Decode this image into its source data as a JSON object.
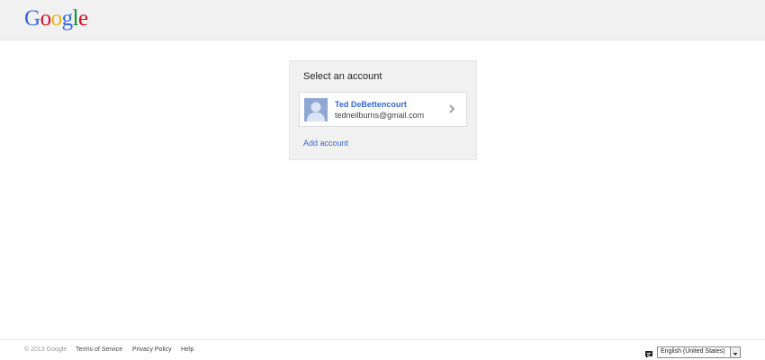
{
  "header": {
    "logo_letters": [
      "G",
      "o",
      "o",
      "g",
      "l",
      "e"
    ]
  },
  "card": {
    "title": "Select an account",
    "account": {
      "name": "Ted DeBettencourt",
      "email": "tedneilburns@gmail.com"
    },
    "add_account_label": "Add account"
  },
  "footer": {
    "copyright": "© 2013 Google",
    "links": [
      "Terms of Service",
      "Privacy Policy",
      "Help"
    ],
    "language_selected": "English (United States)"
  },
  "icons": {
    "logo": "google-logo",
    "avatar": "default-avatar-icon",
    "chevron": "chevron-right-icon",
    "language": "speech-bubble-icon",
    "dropdown": "dropdown-arrow-icon"
  },
  "colors": {
    "link": "#3367d6",
    "header_bg": "#f1f1f1",
    "card_bg": "#f1f1f1"
  }
}
